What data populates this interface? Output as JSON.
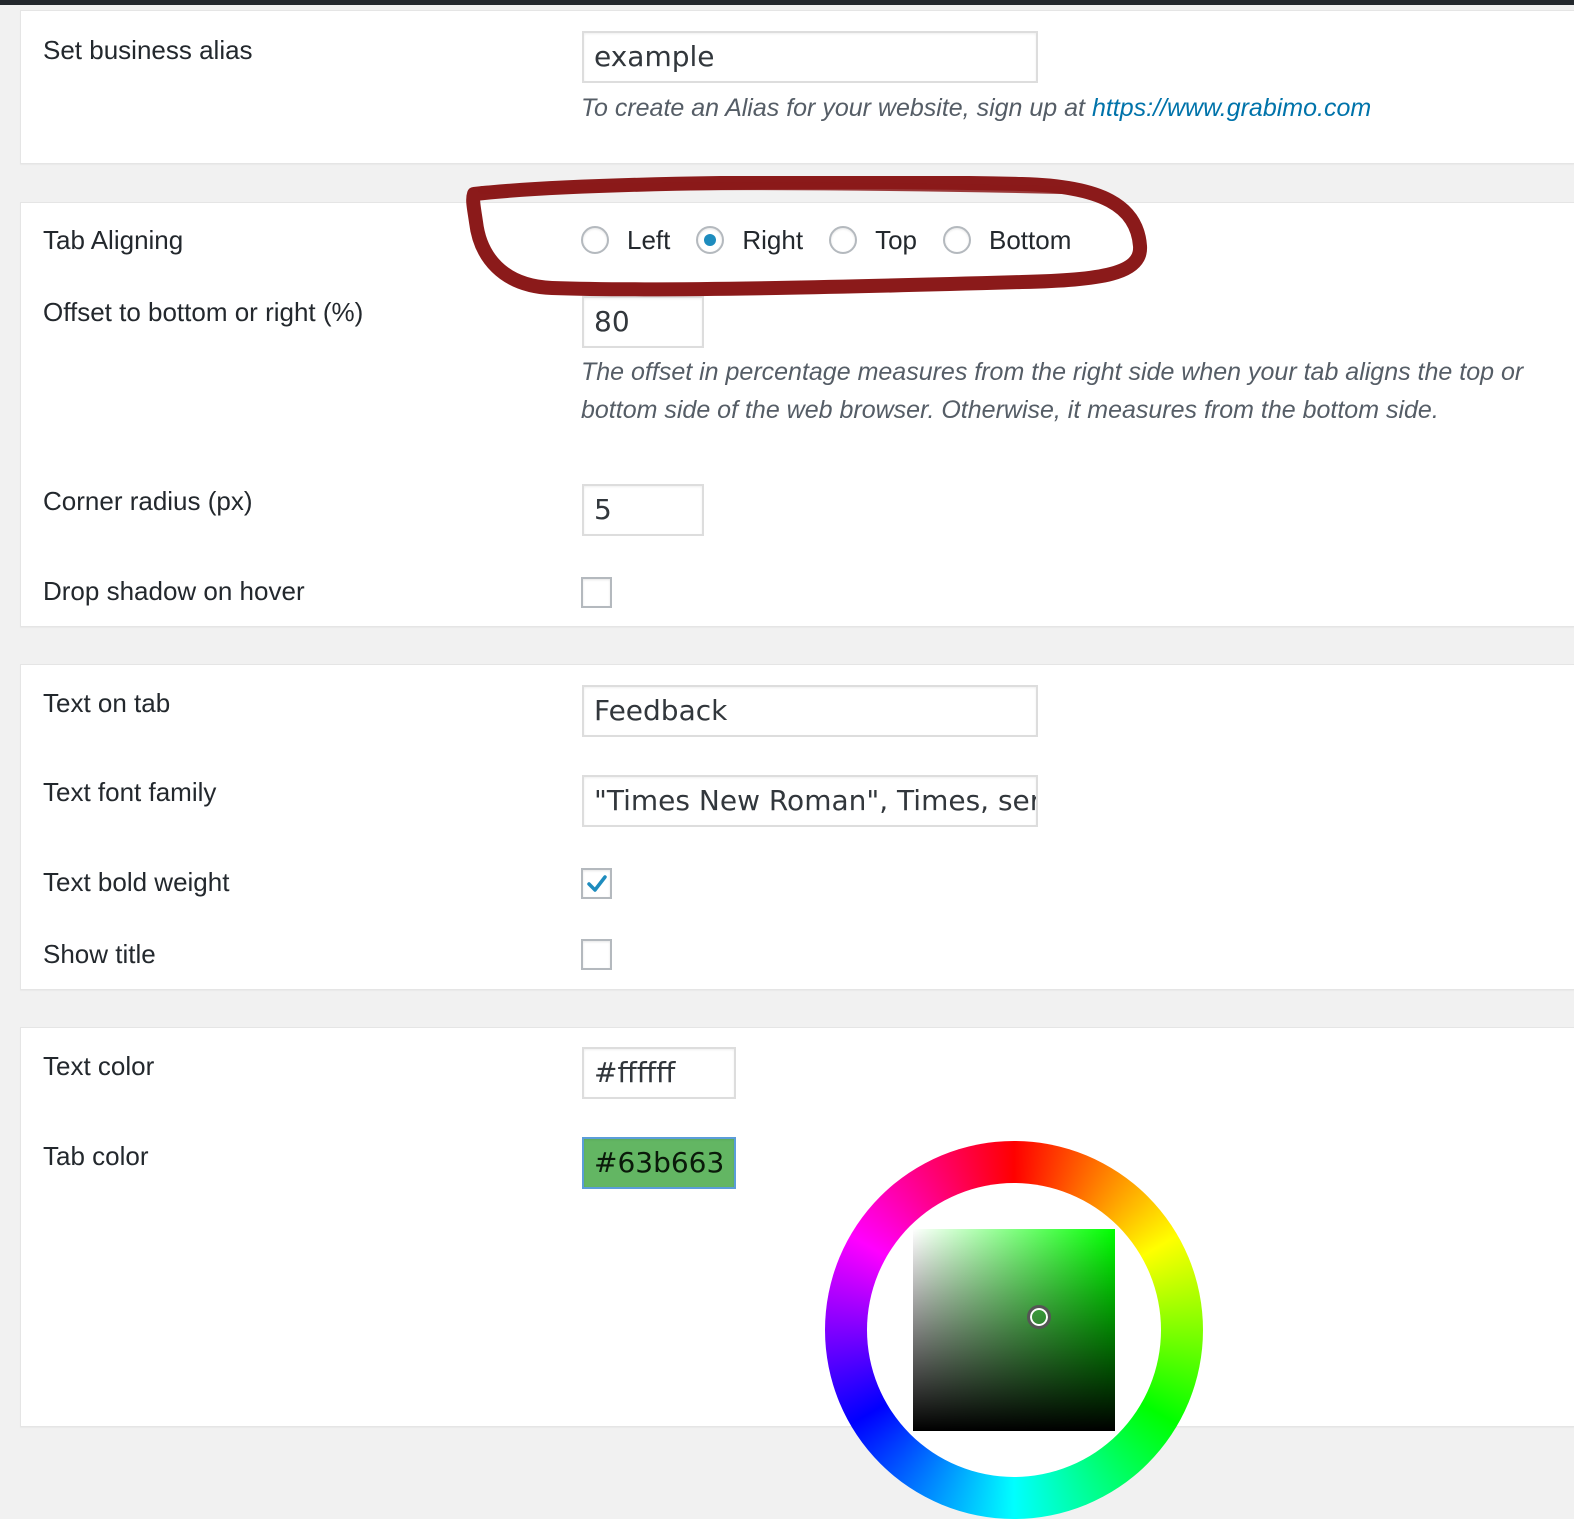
{
  "alias_section": {
    "label": "Set business alias",
    "value": "example",
    "description_prefix": "To create an Alias for your website, sign up at ",
    "description_link": "https://www.grabimo.com"
  },
  "layout_section": {
    "tab_aligning": {
      "label": "Tab Aligning",
      "options": [
        {
          "label": "Left",
          "checked": false
        },
        {
          "label": "Right",
          "checked": true
        },
        {
          "label": "Top",
          "checked": false
        },
        {
          "label": "Bottom",
          "checked": false
        }
      ]
    },
    "offset": {
      "label": "Offset to bottom or right (%)",
      "value": "80",
      "description": "The offset in percentage measures from the right side when your tab aligns the top or bottom side of the web browser. Otherwise, it measures from the bottom side."
    },
    "corner_radius": {
      "label": "Corner radius (px)",
      "value": "5"
    },
    "drop_shadow": {
      "label": "Drop shadow on hover",
      "checked": false
    }
  },
  "text_section": {
    "text_on_tab": {
      "label": "Text on tab",
      "value": "Feedback"
    },
    "font_family": {
      "label": "Text font family",
      "value": "\"Times New Roman\", Times, seri"
    },
    "bold": {
      "label": "Text bold weight",
      "checked": true
    },
    "show_title": {
      "label": "Show title",
      "checked": false
    }
  },
  "color_section": {
    "text_color": {
      "label": "Text color",
      "value": "#ffffff"
    },
    "tab_color": {
      "label": "Tab color",
      "value": "#63b663"
    }
  },
  "colors": {
    "highlight_annotation": "#8b1a1a",
    "checkbox_check": "#1e8cbe",
    "link": "#0073aa",
    "tab_color_swatch": "#63b663",
    "focus_border": "#5b9dd9"
  }
}
